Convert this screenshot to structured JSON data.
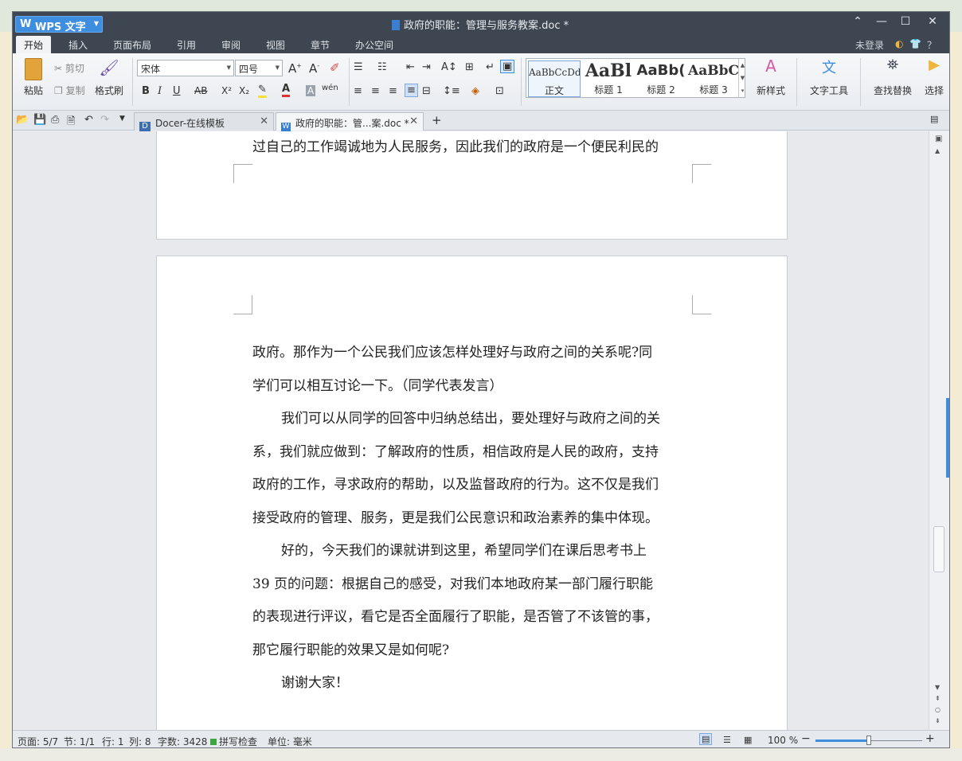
{
  "window": {
    "app_name": "WPS 文字",
    "doc_title": "政府的职能：管理与服务教案.doc *",
    "minimize": "—",
    "maximize": "☐",
    "close": "✕",
    "collapse": "⌃"
  },
  "menu": {
    "tabs": [
      "开始",
      "插入",
      "页面布局",
      "引用",
      "审阅",
      "视图",
      "章节",
      "办公空间"
    ],
    "login": "未登录",
    "help": "？"
  },
  "ribbon": {
    "paste": "粘贴",
    "cut": "剪切",
    "copy": "复制",
    "format_painter": "格式刷",
    "font_name": "宋体",
    "font_size": "四号",
    "bold": "B",
    "italic": "I",
    "underline": "U",
    "strike": "AB",
    "superscript": "X²",
    "subscript": "X₂",
    "font_color": "A",
    "char_shade": "A",
    "phonetic": "wén",
    "styles": [
      {
        "preview": "AaBbCcDd",
        "name": "正文"
      },
      {
        "preview": "AaBl",
        "name": "标题 1"
      },
      {
        "preview": "AaBb(",
        "name": "标题 2"
      },
      {
        "preview": "AaBbC",
        "name": "标题 3"
      }
    ],
    "new_style": "新样式",
    "text_tools": "文字工具",
    "find_replace": "查找替换",
    "select": "选择"
  },
  "tabs": [
    {
      "label": "Docer-在线模板",
      "active": false
    },
    {
      "label": "政府的职能：管...案.doc *",
      "active": true
    }
  ],
  "document": {
    "page1_last_line": "过自己的工作竭诚地为人民服务，因此我们的政府是一个便民利民的",
    "lines": [
      {
        "text": "政府。那作为一个公民我们应该怎样处理好与政府之间的关系呢?同",
        "indent": false
      },
      {
        "text": "学们可以相互讨论一下。（同学代表发言）",
        "indent": false
      },
      {
        "text": "我们可以从同学的回答中归纳总结出，要处理好与政府之间的关",
        "indent": true
      },
      {
        "text": "系，我们就应做到：了解政府的性质，相信政府是人民的政府，支持",
        "indent": false
      },
      {
        "text": "政府的工作，寻求政府的帮助，以及监督政府的行为。这不仅是我们",
        "indent": false
      },
      {
        "text": "接受政府的管理、服务，更是我们公民意识和政治素养的集中体现。",
        "indent": false
      },
      {
        "text": "好的，今天我们的课就讲到这里，希望同学们在课后思考书上",
        "indent": true
      },
      {
        "text": "39 页的问题：根据自己的感受，对我们本地政府某一部门履行职能",
        "indent": false
      },
      {
        "text": "的表现进行评议，看它是否全面履行了职能，是否管了不该管的事，",
        "indent": false
      },
      {
        "text": "那它履行职能的效果又是如何呢?",
        "indent": false
      },
      {
        "text": "谢谢大家！",
        "indent": true
      }
    ]
  },
  "status": {
    "page": "页面: 5/7",
    "section": "节: 1/1",
    "row": "行: 1",
    "col": "列: 8",
    "word_count": "字数: 3428",
    "spell_check": "拼写检查",
    "unit": "单位: 毫米",
    "zoom": "100 %",
    "zoom_fraction": 0.5
  },
  "colors": {
    "titlebar": "#3e4652",
    "accent": "#3e8ee0"
  }
}
